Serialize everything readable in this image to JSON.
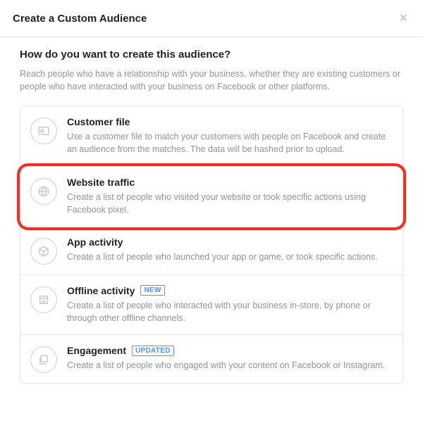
{
  "header": {
    "title": "Create a Custom Audience"
  },
  "body": {
    "question": "How do you want to create this audience?",
    "subtext": "Reach people who have a relationship with your business, whether they are existing customers or people who have interacted with your business on Facebook or other platforms."
  },
  "options": [
    {
      "title": "Customer file",
      "desc": "Use a customer file to match your customers with people on Facebook and create an audience from the matches. The data will be hashed prior to upload.",
      "badge": ""
    },
    {
      "title": "Website traffic",
      "desc": "Create a list of people who visited your website or took specific actions using Facebook pixel.",
      "badge": ""
    },
    {
      "title": "App activity",
      "desc": "Create a list of people who launched your app or game, or took specific actions.",
      "badge": ""
    },
    {
      "title": "Offline activity",
      "desc": "Create a list of people who interacted with your business in-store, by phone or through other offline channels.",
      "badge": "NEW"
    },
    {
      "title": "Engagement",
      "desc": "Create a list of people who engaged with your content on Facebook or Instagram.",
      "badge": "UPDATED"
    }
  ]
}
